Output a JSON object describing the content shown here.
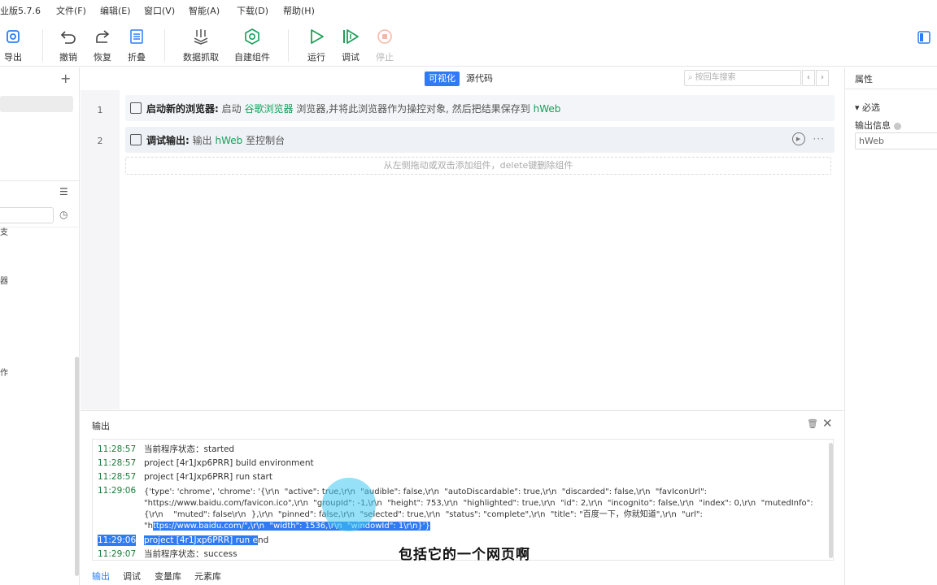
{
  "app": {
    "title_fragment": "业版5.7.6"
  },
  "menu": [
    "文件(F)",
    "编辑(E)",
    "窗口(V)",
    "智能(A)",
    "下载(D)",
    "帮助(H)"
  ],
  "toolbar": {
    "export": "导出",
    "undo": "撤销",
    "redo": "恢复",
    "fold": "折叠",
    "data_capture": "数据抓取",
    "custom_component": "自建组件",
    "run": "运行",
    "debug": "调试",
    "stop": "停止"
  },
  "left_panel": {
    "trunc_labels": [
      "支",
      "器",
      "作"
    ]
  },
  "editor": {
    "tabs": {
      "visual": "可视化",
      "source": "源代码"
    },
    "search_placeholder": "按回车搜索",
    "steps": [
      {
        "line": "1",
        "title": "启动新的浏览器:",
        "t1": "启动",
        "v1": "谷歌浏览器",
        "t2": "浏览器,并将此浏览器作为操控对象, 然后把结果保存到",
        "v2": "hWeb"
      },
      {
        "line": "2",
        "title": "调试输出:",
        "t1": "输出",
        "v1": "hWeb",
        "t2": "至控制台"
      }
    ],
    "drop_hint": "从左侧拖动或双击添加组件，delete键删除组件"
  },
  "properties": {
    "title": "属性",
    "required_section": "▾ 必选",
    "output_label": "输出信息",
    "output_value": "hWeb"
  },
  "output": {
    "title": "输出",
    "logs": [
      {
        "time": "11:28:57",
        "text": "当前程序状态：started"
      },
      {
        "time": "11:28:57",
        "text": "project [4r1Jxp6PRR] build environment"
      },
      {
        "time": "11:28:57",
        "text": "project [4r1Jxp6PRR] run start"
      },
      {
        "time": "11:29:06",
        "json_lines": [
          "{'type': 'chrome', 'chrome': '{\\r\\n  \"active\": true,\\r\\n  \"audible\": false,\\r\\n  \"autoDiscardable\": true,\\r\\n  \"discarded\": false,\\r\\n  \"favIconUrl\":",
          "\"https://www.baidu.com/favicon.ico\",\\r\\n  \"groupId\": -1,\\r\\n  \"height\": 753,\\r\\n  \"highlighted\": true,\\r\\n  \"id\": 2,\\r\\n  \"incognito\": false,\\r\\n  \"index\": 0,\\r\\n  \"mutedInfo\":",
          "{\\r\\n    \"muted\": false\\r\\n  },\\r\\n  \"pinned\": false,\\r\\n  \"selected\": true,\\r\\n  \"status\": \"complete\",\\r\\n  \"title\": \"百度一下，你就知道\",\\r\\n  \"url\":"
        ],
        "last_plain": "\"h",
        "last_sel": "ttps://www.baidu.com/\",\\r\\n  \"width\": 1536,\\r\\n  \"windowId\": 1\\r\\n}'}"
      },
      {
        "time": "11:29:06",
        "sel_text": "project [4r1Jxp6PRR] run e",
        "plain_text": "nd"
      },
      {
        "time": "11:29:07",
        "text": "当前程序状态：success"
      }
    ],
    "tabs": [
      "输出",
      "调试",
      "变量库",
      "元素库"
    ]
  },
  "subtitle": "包括它的一个网页啊",
  "colors": {
    "accent": "#2f7bf6",
    "variable": "#14a05a",
    "run": "#1fa05a"
  }
}
